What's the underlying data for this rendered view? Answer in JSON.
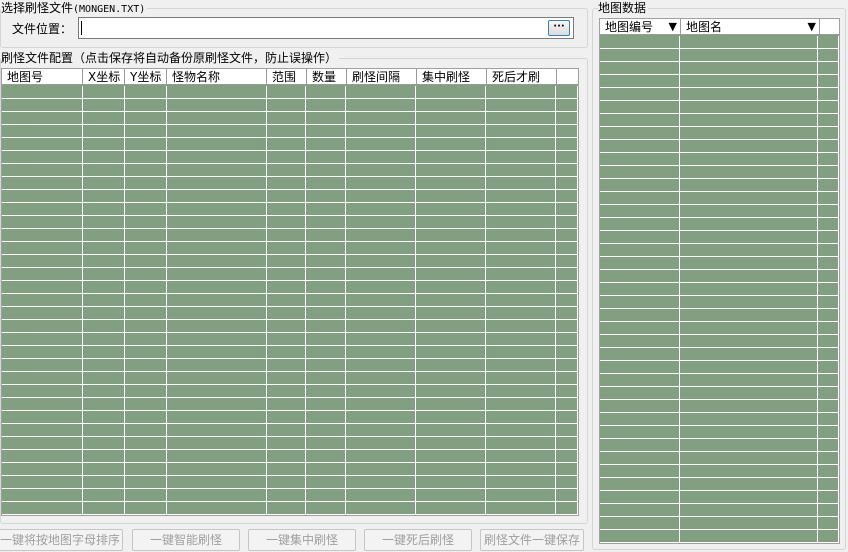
{
  "select_file_group": {
    "title": "选择刷怪文件",
    "title_suffix": "(MONGEN.TXT)",
    "file_label": "文件位置：",
    "file_value": "",
    "browse_label": "···"
  },
  "config_group": {
    "title": "刷怪文件配置（点击保存将自动备份原刷怪文件，防止误操作）",
    "columns": [
      "地图号",
      "X坐标",
      "Y坐标",
      "怪物名称",
      "范围",
      "数量",
      "刷怪间隔",
      "集中刷怪",
      "死后才刷"
    ],
    "row_count": 33
  },
  "map_group": {
    "title": "地图数据",
    "columns": [
      "地图编号",
      "地图名"
    ],
    "sort_icon": "▼",
    "row_count": 40
  },
  "buttons": {
    "sort_by_letter": "一键将按地图字母排序",
    "smart_spawn": "一键智能刷怪",
    "concentrated_spawn": "一键集中刷怪",
    "spawn_after_death": "一键死后刷怪",
    "save_file": "刷怪文件一键保存"
  },
  "colors": {
    "grid_background": "#839f81",
    "grid_lines": "#ffffff",
    "window_background": "#f0f0f0"
  }
}
